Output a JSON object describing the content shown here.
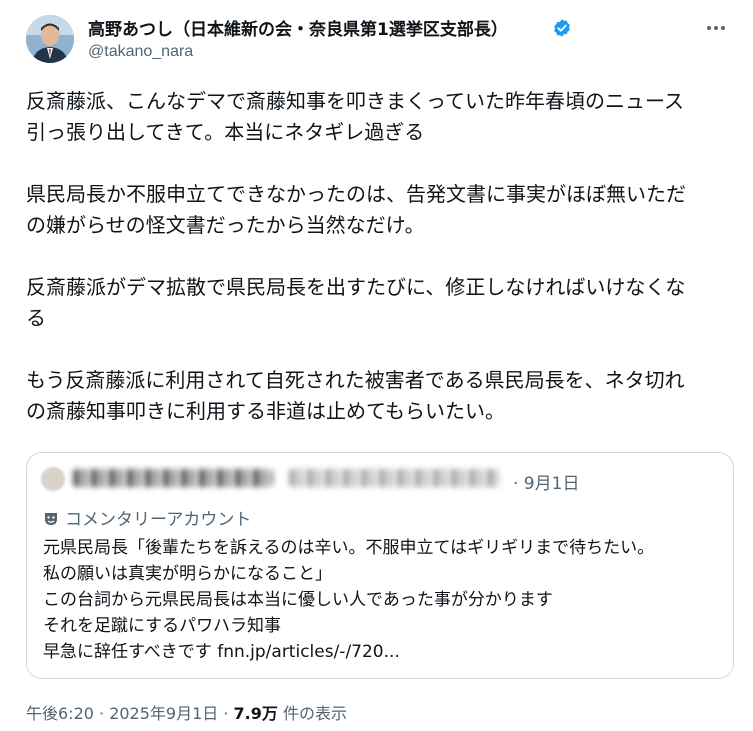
{
  "author": {
    "name": "高野あつし（日本維新の会・奈良県第1選挙区支部長）",
    "handle": "@takano_nara",
    "verified_color": "#1d9bf0"
  },
  "tweet_body": {
    "lines": [
      "反斎藤派、こんなデマで斎藤知事を叩きまくっていた昨年春頃のニュース",
      "引っ張り出してきて。本当にネタギレ過ぎる",
      "",
      "県民局長か不服申立てできなかったのは、告発文書に事実がほぼ無いただ",
      "の嫌がらせの怪文書だったから当然なだけ。",
      "",
      "反斎藤派がデマ拡散で県民局長を出すたびに、修正しなければいけなくな",
      "る",
      "",
      "もう反斎藤派に利用されて自死された被害者である県民局長を、ネタ切れ",
      "の斎藤知事叩きに利用する非道は止めてもらいたい。"
    ]
  },
  "quoted_tweet": {
    "date": "· 9月1日",
    "commentary_label": "コメンタリーアカウント",
    "lines": [
      "元県民局長「後輩たちを訴えるのは辛い。不服申立てはギリギリまで待ちたい。",
      "私の願いは真実が明らかになること」",
      "この台詞から元県民局長は本当に優しい人であった事が分かります",
      "それを足蹴にするパワハラ知事"
    ],
    "last_line_text": "早急に辞任すべきです ",
    "link": "fnn.jp/articles/-/720..."
  },
  "footer": {
    "time": "午後6:20 · 2025年9月1日 · ",
    "views": "7.9万",
    "views_label": " 件の表示"
  },
  "icons": {
    "more": "more-icon",
    "verified": "verified-badge-icon",
    "commentary": "theater-mask-icon"
  }
}
